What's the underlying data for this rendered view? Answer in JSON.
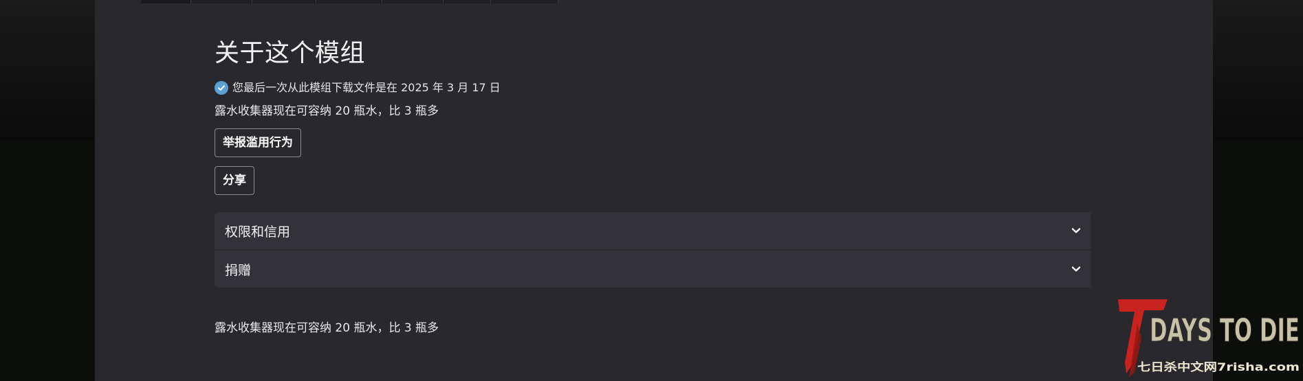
{
  "about": {
    "title": "关于这个模组",
    "download_note": "您最后一次从此模组下载文件是在 2025 年 3 月 17 日",
    "summary": "露水收集器现在可容纳 20 瓶水，比 3 瓶多"
  },
  "actions": {
    "report_label": "举报滥用行为",
    "share_label": "分享"
  },
  "accordion": [
    {
      "label": "权限和信用",
      "icon": "chevron-down-icon"
    },
    {
      "label": "捐赠",
      "icon": "chevron-down-icon"
    }
  ],
  "description": "露水收集器现在可容纳 20 瓶水，比 3 瓶多",
  "watermark": {
    "logo_text": "7DAYS TO DIE",
    "site_text": "七日杀中文网7risha.com"
  },
  "colors": {
    "panel_bg": "#29282d",
    "accordion_bg": "#333238",
    "check_blue": "#5c9fd2",
    "logo_red": "#c8231e"
  }
}
